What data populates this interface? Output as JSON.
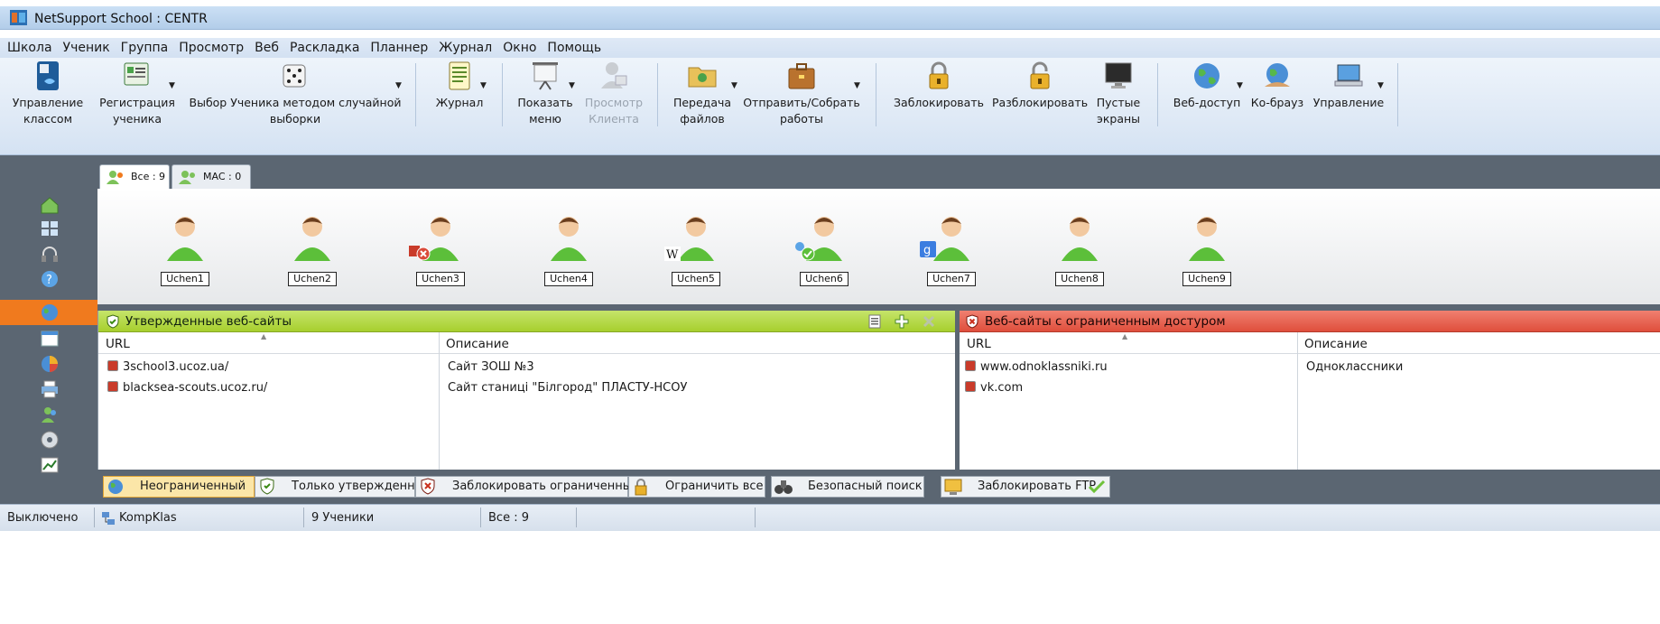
{
  "window": {
    "title": "NetSupport School : CENTR"
  },
  "menu": [
    "Школа",
    "Ученик",
    "Группа",
    "Просмотр",
    "Веб",
    "Раскладка",
    "Планнер",
    "Журнал",
    "Окно",
    "Помощь"
  ],
  "toolbar": {
    "manage_class": [
      "Управление",
      "классом"
    ],
    "register": [
      "Регистрация",
      "ученика"
    ],
    "random": [
      "Выбор Ученика методом случайной",
      "выборки"
    ],
    "journal": "Журнал",
    "show_menu": [
      "Показать",
      "меню"
    ],
    "view_client": [
      "Просмотр",
      "Клиента"
    ],
    "transfer": [
      "Передача",
      "файлов"
    ],
    "send_collect": [
      "Отправить/Собрать",
      "работы"
    ],
    "lock": "Заблокировать",
    "unlock": "Разблокировать",
    "blank": [
      "Пустые",
      "экраны"
    ],
    "web_access": "Веб-доступ",
    "cobrowse": "Ко-брауз",
    "manage": "Управление"
  },
  "tabs": [
    {
      "label": "Все : 9"
    },
    {
      "label": "MAC : 0"
    }
  ],
  "students": [
    "Uchen1",
    "Uchen2",
    "Uchen3",
    "Uchen4",
    "Uchen5",
    "Uchen6",
    "Uchen7",
    "Uchen8",
    "Uchen9"
  ],
  "approved": {
    "title": "Утвержденные веб-сайты",
    "col_url": "URL",
    "col_desc": "Описание",
    "rows": [
      {
        "url": "3school3.ucoz.ua/",
        "desc": "Сайт ЗОШ №3"
      },
      {
        "url": "blacksea-scouts.ucoz.ru/",
        "desc": "Сайт станиці \"Білгород\" ПЛАСТУ-НСОУ"
      }
    ]
  },
  "restricted": {
    "title": "Веб-сайты с ограниченным достуром",
    "col_url": "URL",
    "col_desc": "Описание",
    "rows": [
      {
        "url": "www.odnoklassniki.ru",
        "desc": "Одноклассники"
      },
      {
        "url": "vk.com",
        "desc": ""
      }
    ]
  },
  "modes": {
    "unrestricted": "Неограниченный",
    "approved_only": "Только утвержденные",
    "block_restricted": "Заблокировать ограниченные",
    "restrict_all": "Ограничить все",
    "safe_search": "Безопасный поиск",
    "block_ftp": "Заблокировать FTP"
  },
  "status": {
    "state": "Выключено",
    "computer": "KompKlas",
    "students": "9 Ученики",
    "group": "Все : 9"
  }
}
